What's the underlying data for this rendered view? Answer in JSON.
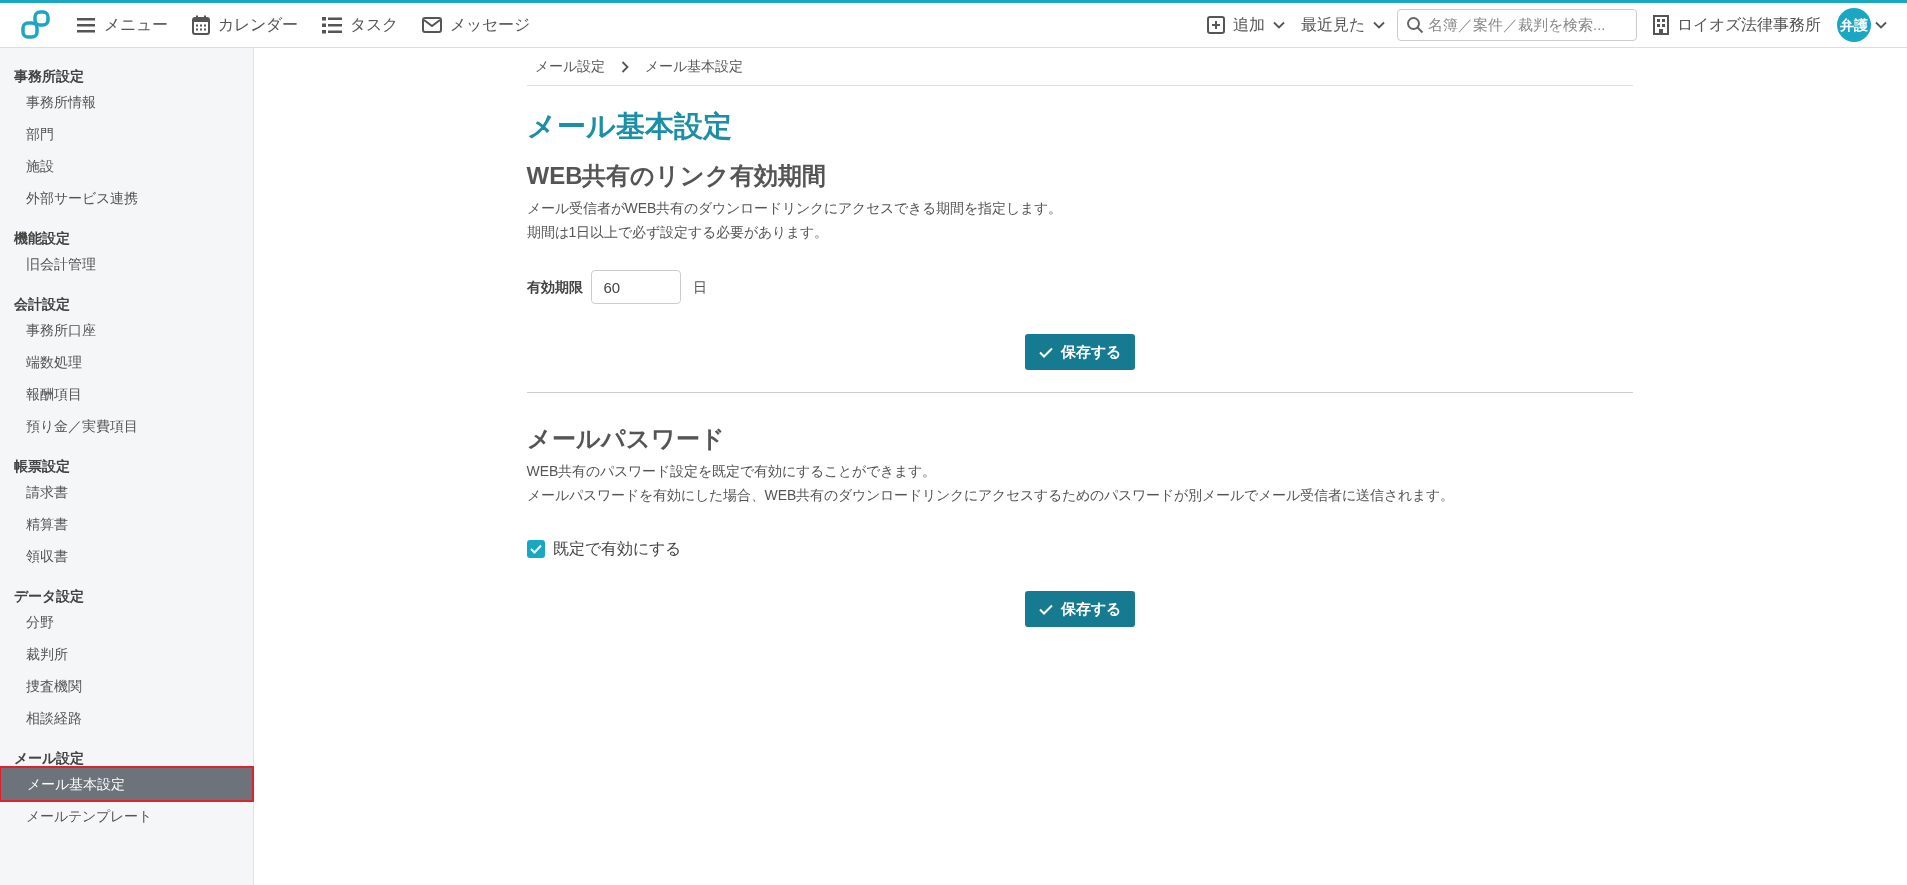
{
  "header": {
    "nav": [
      {
        "kind": "menu",
        "label": "メニュー"
      },
      {
        "kind": "calendar",
        "label": "カレンダー"
      },
      {
        "kind": "tasks",
        "label": "タスク"
      },
      {
        "kind": "message",
        "label": "メッセージ"
      }
    ],
    "add": "追加",
    "recent": "最近見た",
    "search": {
      "placeholder": "名簿／案件／裁判を検索..."
    },
    "office": "ロイオズ法律事務所",
    "avatar": "弁護"
  },
  "sidebar": {
    "groups": [
      {
        "title": "事務所設定",
        "items": [
          {
            "label": "事務所情報",
            "selected": false
          },
          {
            "label": "部門",
            "selected": false
          },
          {
            "label": "施設",
            "selected": false
          },
          {
            "label": "外部サービス連携",
            "selected": false
          }
        ]
      },
      {
        "title": "機能設定",
        "items": [
          {
            "label": "旧会計管理",
            "selected": false
          }
        ]
      },
      {
        "title": "会計設定",
        "items": [
          {
            "label": "事務所口座",
            "selected": false
          },
          {
            "label": "端数処理",
            "selected": false
          },
          {
            "label": "報酬項目",
            "selected": false
          },
          {
            "label": "預り金／実費項目",
            "selected": false
          }
        ]
      },
      {
        "title": "帳票設定",
        "items": [
          {
            "label": "請求書",
            "selected": false
          },
          {
            "label": "精算書",
            "selected": false
          },
          {
            "label": "領収書",
            "selected": false
          }
        ]
      },
      {
        "title": "データ設定",
        "items": [
          {
            "label": "分野",
            "selected": false
          },
          {
            "label": "裁判所",
            "selected": false
          },
          {
            "label": "捜査機関",
            "selected": false
          },
          {
            "label": "相談経路",
            "selected": false
          }
        ]
      },
      {
        "title": "メール設定",
        "items": [
          {
            "label": "メール基本設定",
            "selected": true
          },
          {
            "label": "メールテンプレート",
            "selected": false
          }
        ]
      }
    ]
  },
  "breadcrumb": [
    "メール設定",
    "メール基本設定"
  ],
  "title": "メール基本設定",
  "sections": [
    {
      "heading": "WEB共有のリンク有効期間",
      "lines": [
        "メール受信者がWEB共有のダウンロードリンクにアクセスできる期間を指定します。",
        "期間は1日以上で必ず設定する必要があります。"
      ],
      "kind": "number",
      "field": {
        "label": "有効期限",
        "value": "60",
        "unit": "日"
      },
      "button": "保存する"
    },
    {
      "heading": "メールパスワード",
      "lines": [
        "WEB共有のパスワード設定を既定で有効にすることができます。",
        "メールパスワードを有効にした場合、WEB共有のダウンロードリンクにアクセスするためのパスワードが別メールでメール受信者に送信されます。"
      ],
      "kind": "checkbox",
      "checkbox": {
        "label": "既定で有効にする",
        "checked": true
      },
      "button": "保存する"
    }
  ]
}
